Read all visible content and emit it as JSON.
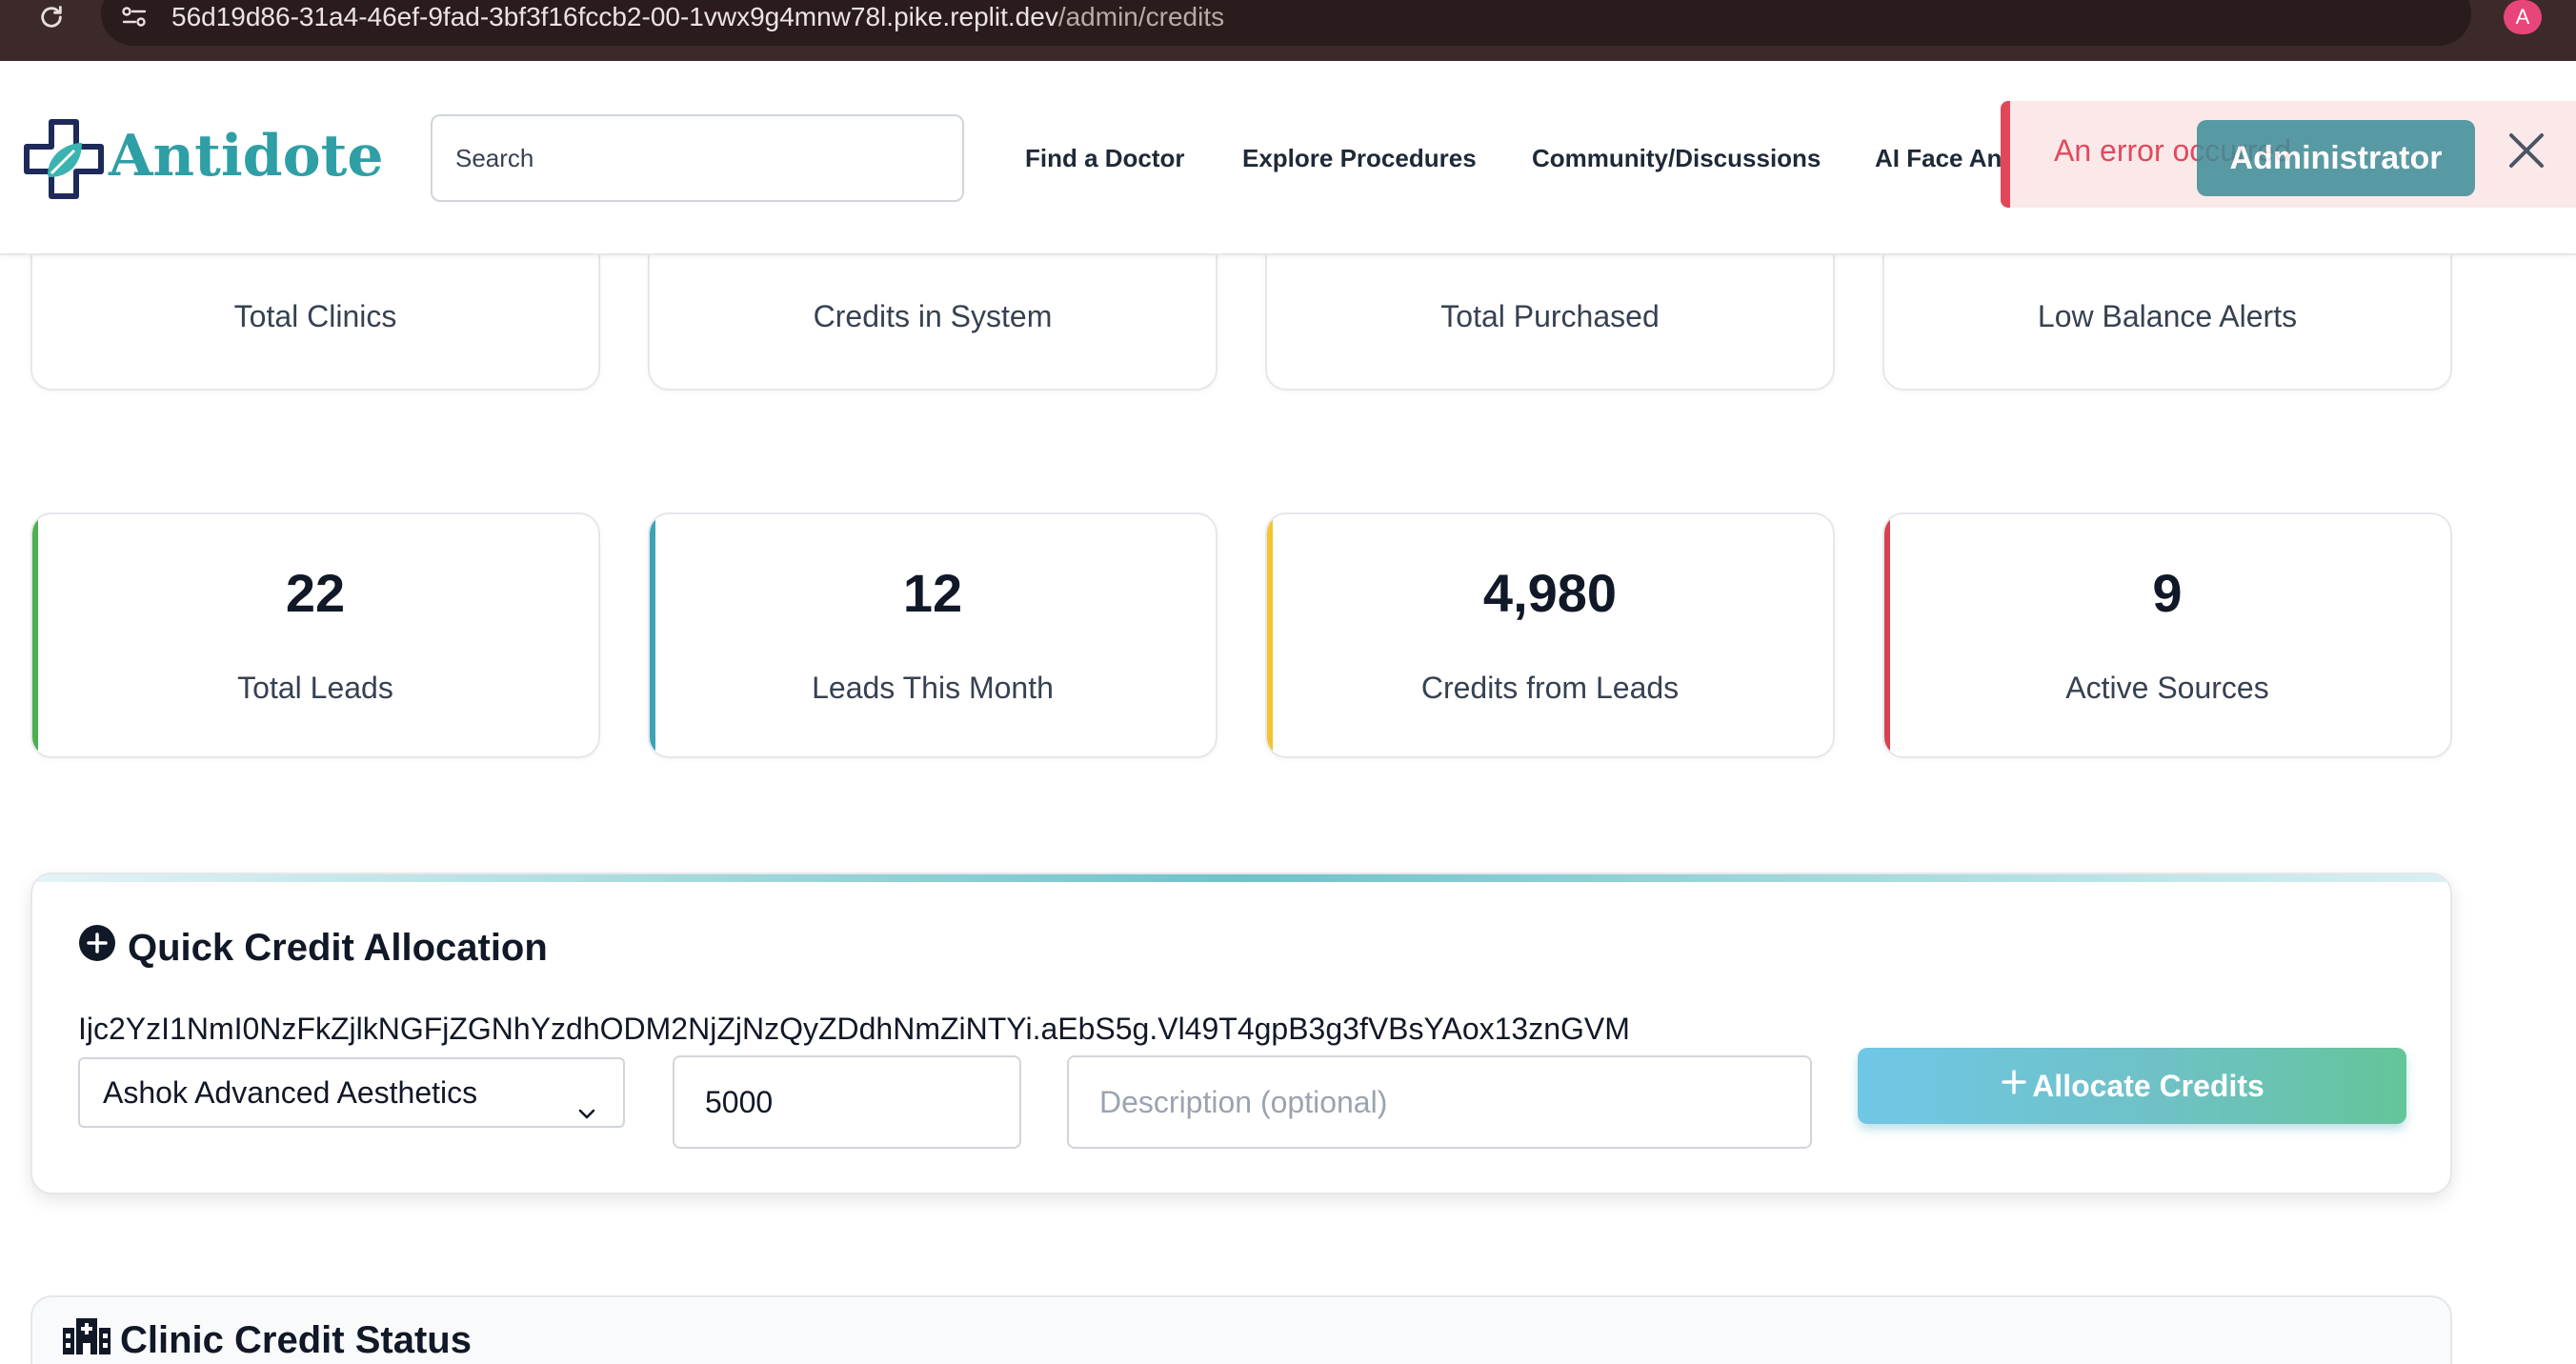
{
  "browser": {
    "url_host": "56d19d86-31a4-46ef-9fad-3bf3f16fccb2-00-1vwx9g4mnw78l.pike.replit.dev",
    "url_path": "/admin/credits",
    "profile_initial": "A"
  },
  "header": {
    "brand": "Antidote",
    "search_placeholder": "Search",
    "nav": [
      "Find a Doctor",
      "Explore Procedures",
      "Community/Discussions",
      "AI Face Analysis"
    ],
    "admin_label": "Administrator",
    "toast_message": "An error occurred"
  },
  "top_stats": [
    {
      "label": "Total Clinics"
    },
    {
      "label": "Credits in System"
    },
    {
      "label": "Total Purchased"
    },
    {
      "label": "Low Balance Alerts"
    }
  ],
  "lead_stats": [
    {
      "value": "22",
      "label": "Total Leads",
      "accent": "#4caf50"
    },
    {
      "value": "12",
      "label": "Leads This Month",
      "accent": "#3aa3b5"
    },
    {
      "value": "4,980",
      "label": "Credits from Leads",
      "accent": "#f4c430"
    },
    {
      "value": "9",
      "label": "Active Sources",
      "accent": "#d9414f"
    }
  ],
  "allocation": {
    "title": "Quick Credit Allocation",
    "token": "Ijc2YzI1NmI0NzFkZjlkNGFjZGNhYzdhODM2NjZjNzQyZDdhNmZiNTYi.aEbS5g.Vl49T4gpB3g3fVBsYAox13znGVM",
    "clinic_selected": "Ashok Advanced Aesthetics",
    "amount_value": "5000",
    "description_placeholder": "Description (optional)",
    "button_label": "Allocate Credits"
  },
  "status": {
    "title": "Clinic Credit Status"
  }
}
